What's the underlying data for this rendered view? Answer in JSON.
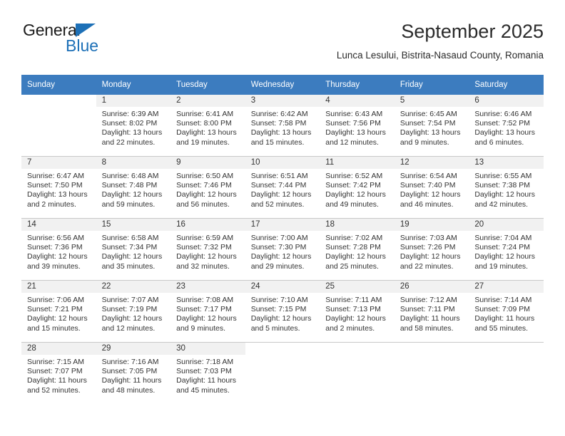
{
  "brand": {
    "name_top": "General",
    "name_bottom": "Blue",
    "triangle_icon": "brand-triangle-icon",
    "accent_color": "#1d70b7"
  },
  "header": {
    "title": "September 2025",
    "subtitle": "Lunca Lesului, Bistrita-Nasaud County, Romania"
  },
  "colors": {
    "header_row": "#3c7cbf",
    "daynum_band": "#f1f1f1",
    "grid_line": "#c8c8c8",
    "text": "#333333"
  },
  "calendar": {
    "weekday_headers": [
      "Sunday",
      "Monday",
      "Tuesday",
      "Wednesday",
      "Thursday",
      "Friday",
      "Saturday"
    ],
    "weeks": [
      [
        {
          "day": "",
          "sunrise": "",
          "sunset": "",
          "daylight": ""
        },
        {
          "day": "1",
          "sunrise": "Sunrise: 6:39 AM",
          "sunset": "Sunset: 8:02 PM",
          "daylight": "Daylight: 13 hours and 22 minutes."
        },
        {
          "day": "2",
          "sunrise": "Sunrise: 6:41 AM",
          "sunset": "Sunset: 8:00 PM",
          "daylight": "Daylight: 13 hours and 19 minutes."
        },
        {
          "day": "3",
          "sunrise": "Sunrise: 6:42 AM",
          "sunset": "Sunset: 7:58 PM",
          "daylight": "Daylight: 13 hours and 15 minutes."
        },
        {
          "day": "4",
          "sunrise": "Sunrise: 6:43 AM",
          "sunset": "Sunset: 7:56 PM",
          "daylight": "Daylight: 13 hours and 12 minutes."
        },
        {
          "day": "5",
          "sunrise": "Sunrise: 6:45 AM",
          "sunset": "Sunset: 7:54 PM",
          "daylight": "Daylight: 13 hours and 9 minutes."
        },
        {
          "day": "6",
          "sunrise": "Sunrise: 6:46 AM",
          "sunset": "Sunset: 7:52 PM",
          "daylight": "Daylight: 13 hours and 6 minutes."
        }
      ],
      [
        {
          "day": "7",
          "sunrise": "Sunrise: 6:47 AM",
          "sunset": "Sunset: 7:50 PM",
          "daylight": "Daylight: 13 hours and 2 minutes."
        },
        {
          "day": "8",
          "sunrise": "Sunrise: 6:48 AM",
          "sunset": "Sunset: 7:48 PM",
          "daylight": "Daylight: 12 hours and 59 minutes."
        },
        {
          "day": "9",
          "sunrise": "Sunrise: 6:50 AM",
          "sunset": "Sunset: 7:46 PM",
          "daylight": "Daylight: 12 hours and 56 minutes."
        },
        {
          "day": "10",
          "sunrise": "Sunrise: 6:51 AM",
          "sunset": "Sunset: 7:44 PM",
          "daylight": "Daylight: 12 hours and 52 minutes."
        },
        {
          "day": "11",
          "sunrise": "Sunrise: 6:52 AM",
          "sunset": "Sunset: 7:42 PM",
          "daylight": "Daylight: 12 hours and 49 minutes."
        },
        {
          "day": "12",
          "sunrise": "Sunrise: 6:54 AM",
          "sunset": "Sunset: 7:40 PM",
          "daylight": "Daylight: 12 hours and 46 minutes."
        },
        {
          "day": "13",
          "sunrise": "Sunrise: 6:55 AM",
          "sunset": "Sunset: 7:38 PM",
          "daylight": "Daylight: 12 hours and 42 minutes."
        }
      ],
      [
        {
          "day": "14",
          "sunrise": "Sunrise: 6:56 AM",
          "sunset": "Sunset: 7:36 PM",
          "daylight": "Daylight: 12 hours and 39 minutes."
        },
        {
          "day": "15",
          "sunrise": "Sunrise: 6:58 AM",
          "sunset": "Sunset: 7:34 PM",
          "daylight": "Daylight: 12 hours and 35 minutes."
        },
        {
          "day": "16",
          "sunrise": "Sunrise: 6:59 AM",
          "sunset": "Sunset: 7:32 PM",
          "daylight": "Daylight: 12 hours and 32 minutes."
        },
        {
          "day": "17",
          "sunrise": "Sunrise: 7:00 AM",
          "sunset": "Sunset: 7:30 PM",
          "daylight": "Daylight: 12 hours and 29 minutes."
        },
        {
          "day": "18",
          "sunrise": "Sunrise: 7:02 AM",
          "sunset": "Sunset: 7:28 PM",
          "daylight": "Daylight: 12 hours and 25 minutes."
        },
        {
          "day": "19",
          "sunrise": "Sunrise: 7:03 AM",
          "sunset": "Sunset: 7:26 PM",
          "daylight": "Daylight: 12 hours and 22 minutes."
        },
        {
          "day": "20",
          "sunrise": "Sunrise: 7:04 AM",
          "sunset": "Sunset: 7:24 PM",
          "daylight": "Daylight: 12 hours and 19 minutes."
        }
      ],
      [
        {
          "day": "21",
          "sunrise": "Sunrise: 7:06 AM",
          "sunset": "Sunset: 7:21 PM",
          "daylight": "Daylight: 12 hours and 15 minutes."
        },
        {
          "day": "22",
          "sunrise": "Sunrise: 7:07 AM",
          "sunset": "Sunset: 7:19 PM",
          "daylight": "Daylight: 12 hours and 12 minutes."
        },
        {
          "day": "23",
          "sunrise": "Sunrise: 7:08 AM",
          "sunset": "Sunset: 7:17 PM",
          "daylight": "Daylight: 12 hours and 9 minutes."
        },
        {
          "day": "24",
          "sunrise": "Sunrise: 7:10 AM",
          "sunset": "Sunset: 7:15 PM",
          "daylight": "Daylight: 12 hours and 5 minutes."
        },
        {
          "day": "25",
          "sunrise": "Sunrise: 7:11 AM",
          "sunset": "Sunset: 7:13 PM",
          "daylight": "Daylight: 12 hours and 2 minutes."
        },
        {
          "day": "26",
          "sunrise": "Sunrise: 7:12 AM",
          "sunset": "Sunset: 7:11 PM",
          "daylight": "Daylight: 11 hours and 58 minutes."
        },
        {
          "day": "27",
          "sunrise": "Sunrise: 7:14 AM",
          "sunset": "Sunset: 7:09 PM",
          "daylight": "Daylight: 11 hours and 55 minutes."
        }
      ],
      [
        {
          "day": "28",
          "sunrise": "Sunrise: 7:15 AM",
          "sunset": "Sunset: 7:07 PM",
          "daylight": "Daylight: 11 hours and 52 minutes."
        },
        {
          "day": "29",
          "sunrise": "Sunrise: 7:16 AM",
          "sunset": "Sunset: 7:05 PM",
          "daylight": "Daylight: 11 hours and 48 minutes."
        },
        {
          "day": "30",
          "sunrise": "Sunrise: 7:18 AM",
          "sunset": "Sunset: 7:03 PM",
          "daylight": "Daylight: 11 hours and 45 minutes."
        },
        {
          "day": "",
          "sunrise": "",
          "sunset": "",
          "daylight": ""
        },
        {
          "day": "",
          "sunrise": "",
          "sunset": "",
          "daylight": ""
        },
        {
          "day": "",
          "sunrise": "",
          "sunset": "",
          "daylight": ""
        },
        {
          "day": "",
          "sunrise": "",
          "sunset": "",
          "daylight": ""
        }
      ]
    ]
  }
}
